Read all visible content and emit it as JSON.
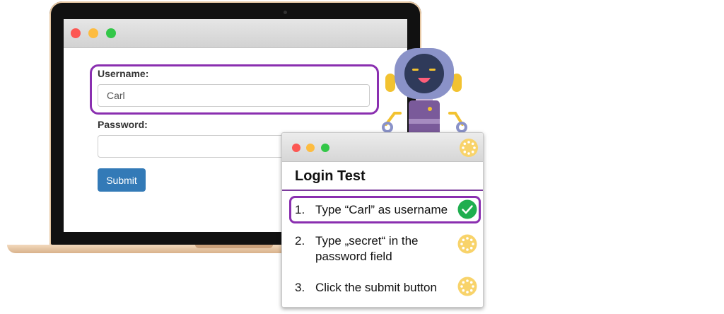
{
  "app": {
    "window_controls": [
      "close",
      "minimize",
      "maximize"
    ]
  },
  "login_form": {
    "username_label": "Username:",
    "username_value": "Carl",
    "password_label": "Password:",
    "password_value": "",
    "submit_label": "Submit"
  },
  "test_panel": {
    "title": "Login Test",
    "header_status_icon": "pending-icon",
    "steps": [
      {
        "number": "1.",
        "lines": [
          "Type “Carl” as username"
        ],
        "status": "done",
        "icon": "check-icon"
      },
      {
        "number": "2.",
        "lines": [
          "Type „secret“ in the",
          "password field"
        ],
        "status": "pending",
        "icon": "pending-icon"
      },
      {
        "number": "3.",
        "lines": [
          "Click the submit button"
        ],
        "status": "pending",
        "icon": "pending-icon"
      }
    ]
  },
  "colors": {
    "highlight": "#8a2fb0",
    "submit_button": "#337ab7",
    "done": "#1fae4f",
    "pending": "#f8d36a",
    "robot_head": "#8a92c8",
    "robot_body": "#7a5a9a",
    "robot_accent": "#f2c230"
  }
}
